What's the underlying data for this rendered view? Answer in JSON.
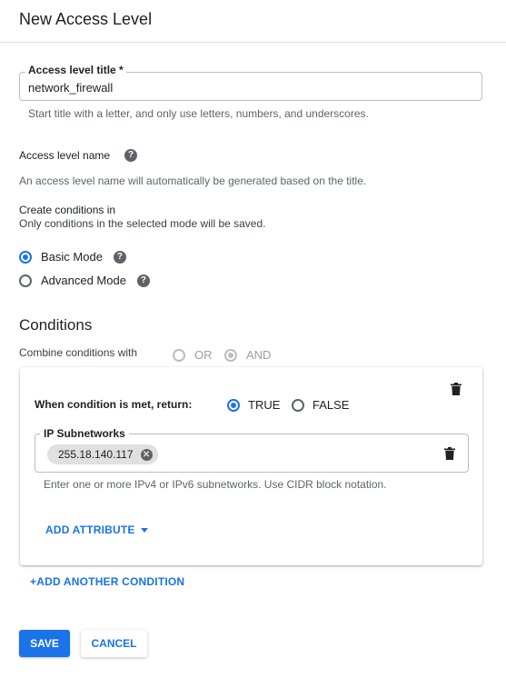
{
  "header": {
    "title": "New Access Level"
  },
  "title_field": {
    "label": "Access level title *",
    "value": "network_firewall",
    "hint": "Start title with a letter, and only use letters, numbers, and underscores."
  },
  "name_section": {
    "label": "Access level name",
    "help_icon": "help-icon",
    "description": "An access level name will automatically be generated based on the title."
  },
  "mode_section": {
    "label": "Create conditions in",
    "sublabel": "Only conditions in the selected mode will be saved.",
    "options": [
      {
        "label": "Basic Mode",
        "checked": true
      },
      {
        "label": "Advanced Mode",
        "checked": false
      }
    ]
  },
  "conditions": {
    "title": "Conditions",
    "combine_label": "Combine conditions with",
    "combine_options": [
      {
        "label": "OR",
        "checked": false,
        "disabled": true
      },
      {
        "label": "AND",
        "checked": true,
        "disabled": true
      }
    ],
    "card": {
      "return_label": "When condition is met, return:",
      "return_options": [
        {
          "label": "TRUE",
          "checked": true
        },
        {
          "label": "FALSE",
          "checked": false
        }
      ],
      "ip_label": "IP Subnetworks",
      "ip_chip": "255.18.140.117",
      "ip_hint": "Enter one or more IPv4 or IPv6 subnetworks. Use CIDR block notation.",
      "add_attribute": "ADD ATTRIBUTE"
    },
    "add_condition": "+ADD ANOTHER CONDITION"
  },
  "actions": {
    "save": "SAVE",
    "cancel": "CANCEL"
  },
  "colors": {
    "accent": "#1a73e8",
    "text": "#202124",
    "muted": "#5f6368"
  }
}
